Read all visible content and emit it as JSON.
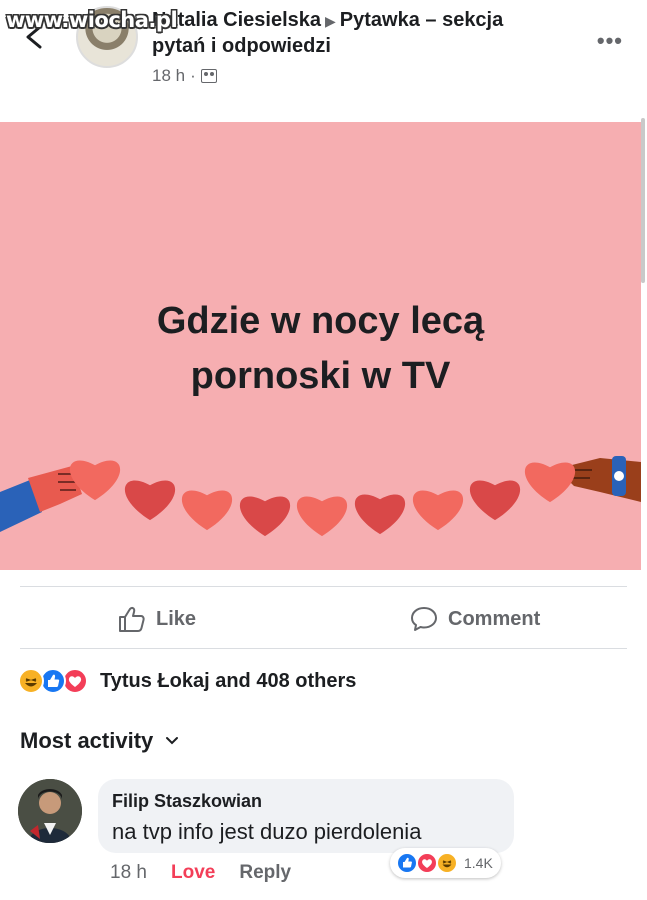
{
  "watermark": "www.wiocha.pl",
  "post": {
    "author": "Natalia Ciesielska",
    "group": "Pytawka – sekcja pytań i odpowiedzi",
    "time": "18 h",
    "image_text_line1": "Gdzie w nocy lecą",
    "image_text_line2": "pornoski w TV",
    "bg_color": "#f6aeb1"
  },
  "actions": {
    "like": "Like",
    "comment": "Comment"
  },
  "reactions": {
    "summary": "Tytus Łokaj and 408 others",
    "types": [
      "haha",
      "like",
      "love"
    ]
  },
  "comments_section": {
    "sort_label": "Most activity"
  },
  "comment": {
    "author": "Filip Staszkowian",
    "text": "na tvp info jest duzo pierdolenia",
    "time": "18 h",
    "love_label": "Love",
    "reply_label": "Reply",
    "reaction_count": "1.4K",
    "reaction_types": [
      "like",
      "love",
      "haha"
    ]
  },
  "colors": {
    "like_blue": "#1877f2",
    "love_red": "#f33e58",
    "haha_yellow": "#f7b125",
    "text_secondary": "#65676b"
  }
}
